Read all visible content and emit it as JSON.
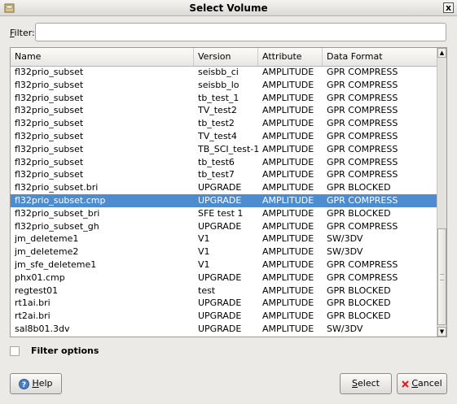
{
  "window": {
    "title": "Select Volume",
    "close_glyph": "x"
  },
  "filter": {
    "label_mnemonic": "F",
    "label_rest": "ilter:",
    "value": ""
  },
  "table": {
    "columns": [
      "Name",
      "Version",
      "Attribute",
      "Data Format"
    ],
    "rows": [
      {
        "name": "fl32prio_subset",
        "version": "seisbb_ci",
        "attribute": "AMPLITUDE",
        "format": "GPR COMPRESS"
      },
      {
        "name": "fl32prio_subset",
        "version": "seisbb_lo",
        "attribute": "AMPLITUDE",
        "format": "GPR COMPRESS"
      },
      {
        "name": "fl32prio_subset",
        "version": "tb_test_1",
        "attribute": "AMPLITUDE",
        "format": "GPR COMPRESS"
      },
      {
        "name": "fl32prio_subset",
        "version": "TV_test2",
        "attribute": "AMPLITUDE",
        "format": "GPR COMPRESS"
      },
      {
        "name": "fl32prio_subset",
        "version": "tb_test2",
        "attribute": "AMPLITUDE",
        "format": "GPR COMPRESS"
      },
      {
        "name": "fl32prio_subset",
        "version": "TV_test4",
        "attribute": "AMPLITUDE",
        "format": "GPR COMPRESS"
      },
      {
        "name": "fl32prio_subset",
        "version": "TB_SCI_test-1",
        "attribute": "AMPLITUDE",
        "format": "GPR COMPRESS"
      },
      {
        "name": "fl32prio_subset",
        "version": "tb_test6",
        "attribute": "AMPLITUDE",
        "format": "GPR COMPRESS"
      },
      {
        "name": "fl32prio_subset",
        "version": "tb_test7",
        "attribute": "AMPLITUDE",
        "format": "GPR COMPRESS"
      },
      {
        "name": "fl32prio_subset.bri",
        "version": "UPGRADE",
        "attribute": "AMPLITUDE",
        "format": "GPR BLOCKED"
      },
      {
        "name": "fl32prio_subset.cmp",
        "version": "UPGRADE",
        "attribute": "AMPLITUDE",
        "format": "GPR COMPRESS",
        "selected": true
      },
      {
        "name": "fl32prio_subset_bri",
        "version": "SFE test 1",
        "attribute": "AMPLITUDE",
        "format": "GPR BLOCKED"
      },
      {
        "name": "fl32prio_subset_gh",
        "version": "UPGRADE",
        "attribute": "AMPLITUDE",
        "format": "GPR COMPRESS"
      },
      {
        "name": "jm_deleteme1",
        "version": "V1",
        "attribute": "AMPLITUDE",
        "format": "SW/3DV"
      },
      {
        "name": "jm_deleteme2",
        "version": "V1",
        "attribute": "AMPLITUDE",
        "format": "SW/3DV"
      },
      {
        "name": "jm_sfe_deleteme1",
        "version": "V1",
        "attribute": "AMPLITUDE",
        "format": "GPR COMPRESS"
      },
      {
        "name": "phx01.cmp",
        "version": "UPGRADE",
        "attribute": "AMPLITUDE",
        "format": "GPR COMPRESS"
      },
      {
        "name": "regtest01",
        "version": "test",
        "attribute": "AMPLITUDE",
        "format": "GPR BLOCKED"
      },
      {
        "name": "rt1ai.bri",
        "version": "UPGRADE",
        "attribute": "AMPLITUDE",
        "format": "GPR BLOCKED"
      },
      {
        "name": "rt2ai.bri",
        "version": "UPGRADE",
        "attribute": "AMPLITUDE",
        "format": "GPR BLOCKED"
      },
      {
        "name": "sal8b01.3dv",
        "version": "UPGRADE",
        "attribute": "AMPLITUDE",
        "format": "SW/3DV"
      }
    ]
  },
  "filter_options": {
    "label": "Filter options",
    "checked": false
  },
  "buttons": {
    "help": {
      "mnemonic": "H",
      "rest": "elp",
      "icon": "help-icon"
    },
    "select": {
      "mnemonic": "S",
      "rest": "elect"
    },
    "cancel": {
      "mnemonic": "C",
      "rest": "ancel",
      "icon": "cancel-x-icon"
    }
  },
  "colors": {
    "selection": "#4d8ccf",
    "window_bg": "#eceae7",
    "cancel_x": "#d81e1e"
  }
}
